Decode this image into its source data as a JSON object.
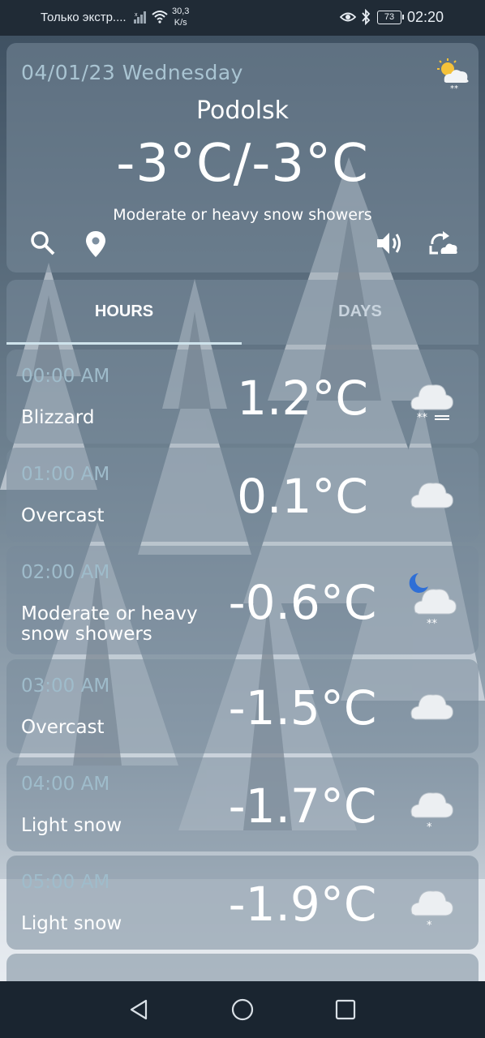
{
  "status_bar": {
    "carrier": "Только экстр....",
    "speed_value": "30,3",
    "speed_unit": "K/s",
    "battery": "73",
    "time": "02:20"
  },
  "header": {
    "date": "04/01/23 Wednesday",
    "city": "Podolsk",
    "temperature": "-3°C/-3°C",
    "condition": "Moderate or heavy snow showers",
    "weather_icon": "sun-cloud-snow-icon"
  },
  "tabs": [
    {
      "label": "HOURS",
      "selected": true
    },
    {
      "label": "DAYS",
      "selected": false
    }
  ],
  "hours": [
    {
      "time": "00:00 AM",
      "condition": "Blizzard",
      "temp": "1.2°C",
      "icon": "blizzard-icon"
    },
    {
      "time": "01:00 AM",
      "condition": "Overcast",
      "temp": "0.1°C",
      "icon": "cloud-icon"
    },
    {
      "time": "02:00 AM",
      "condition": "Moderate or heavy snow showers",
      "temp": "-0.6°C",
      "icon": "moon-cloud-snow-icon"
    },
    {
      "time": "03:00 AM",
      "condition": "Overcast",
      "temp": "-1.5°C",
      "icon": "cloud-icon"
    },
    {
      "time": "04:00 AM",
      "condition": "Light snow",
      "temp": "-1.7°C",
      "icon": "cloud-snow-icon"
    },
    {
      "time": "05:00 AM",
      "condition": "Light snow",
      "temp": "-1.9°C",
      "icon": "cloud-snow-icon"
    }
  ],
  "colors": {
    "date_text": "#a9c4d2",
    "card_bg": "rgba(120,138,155,0.55)",
    "status_bar": "#202b36",
    "nav_bar": "#1a2530"
  }
}
